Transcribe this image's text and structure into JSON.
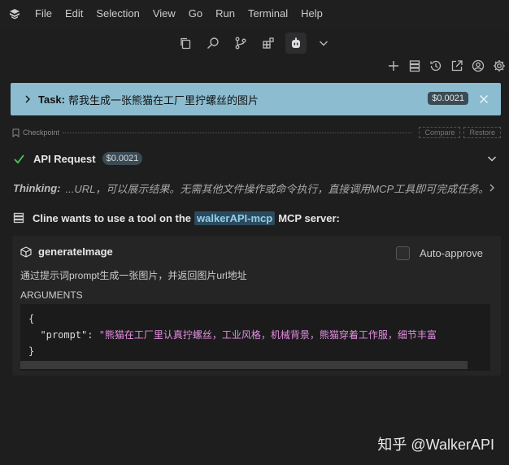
{
  "menu": {
    "items": [
      "File",
      "Edit",
      "Selection",
      "View",
      "Go",
      "Run",
      "Terminal",
      "Help"
    ]
  },
  "toolbar": {
    "icons": [
      "copy-icon",
      "search-icon",
      "source-control-icon",
      "extensions-icon",
      "cline-robot-icon",
      "chevron-down-icon"
    ]
  },
  "panel_toolbar": {
    "icons": [
      "plus-icon",
      "server-icon",
      "history-icon",
      "popout-icon",
      "account-icon",
      "gear-icon"
    ]
  },
  "task": {
    "label": "Task:",
    "text": "帮我生成一张熊猫在工厂里拧螺丝的图片",
    "cost": "$0.0021"
  },
  "checkpoint": {
    "label": "Checkpoint",
    "compare": "Compare",
    "restore": "Restore"
  },
  "api_request": {
    "label": "API Request",
    "cost": "$0.0021"
  },
  "thinking": {
    "label": "Thinking:",
    "text": "...URL，可以展示结果。无需其他文件操作或命令执行，直接调用MCP工具即可完成任务。"
  },
  "cline": {
    "prefix": "Cline wants to use a tool on the",
    "server": "walkerAPI-mcp",
    "suffix": "MCP server:"
  },
  "tool": {
    "name": "generateImage",
    "auto_approve": "Auto-approve",
    "description": "通过提示词prompt生成一张图片，并返回图片url地址",
    "arguments_label": "ARGUMENTS",
    "code_open": "{",
    "arg_key": "\"prompt\"",
    "arg_value": "\"熊猫在工厂里认真拧螺丝，工业风格，机械背景，熊猫穿着工作服，细节丰富",
    "code_close": "}"
  },
  "watermark": "知乎 @WalkerAPI",
  "colors": {
    "background": "#1e1e1f",
    "task_banner": "#8bbcd0",
    "success_check": "#4ec94e",
    "server_badge": "#2c4a5c",
    "json_string": "#e48ee0"
  }
}
